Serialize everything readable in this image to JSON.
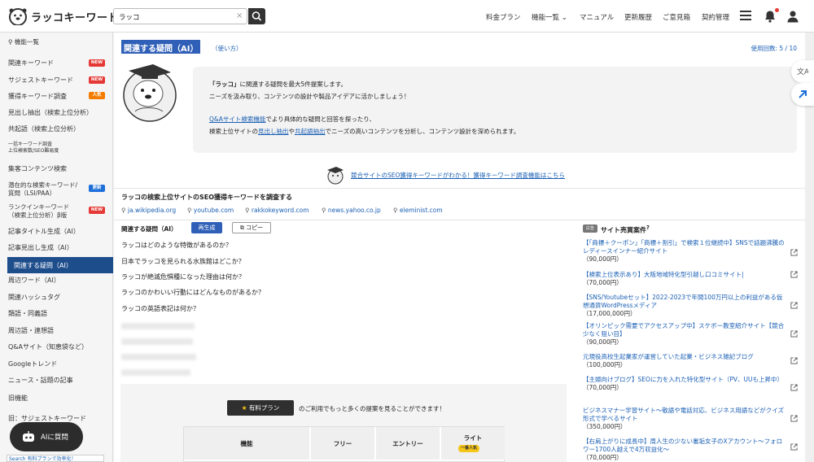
{
  "app": {
    "name": "ラッコキーワード"
  },
  "search": {
    "value": "ラッコ",
    "clear": "×"
  },
  "nav": {
    "items": [
      "料金プラン",
      "機能一覧 ⌄",
      "マニュアル",
      "更新履歴",
      "ご意見箱",
      "契約管理"
    ]
  },
  "sidebar": {
    "heading": "機能一覧",
    "items": [
      {
        "label": "関連キーワード",
        "badge": "NEW"
      },
      {
        "label": "サジェストキーワード",
        "badge": "NEW"
      },
      {
        "label": "獲得キーワード調査",
        "badge": "人気"
      },
      {
        "label": "見出し抽出（検索上位分析）"
      },
      {
        "label": "共起語（検索上位分析）"
      },
      {
        "label": "一括キーワード調査",
        "sub": "上位検索数/SEO難易度"
      },
      {
        "label": "集客コンテンツ検索"
      },
      {
        "label": "潜在的な検索キーワード/",
        "label2": "質問（LSI/PAA）",
        "badge": "更新"
      },
      {
        "label": "ランクインキーワード",
        "label2": "（検索上位分析）β版",
        "badge": "NEW"
      },
      {
        "label": "記事タイトル生成（AI）"
      },
      {
        "label": "記事見出し生成（AI）"
      },
      {
        "label": "関連する疑問（AI）"
      },
      {
        "label": "周辺ワード（AI）"
      },
      {
        "label": "関連ハッシュタグ"
      },
      {
        "label": "類語・同義語"
      },
      {
        "label": "周辺語・連想語"
      },
      {
        "label": "Q&Aサイト（知恵袋など）"
      },
      {
        "label": "Googleトレンド"
      },
      {
        "label": "ニュース・話題の記事"
      },
      {
        "label": "旧機能"
      },
      {
        "label": "旧：サジェストキーワード"
      }
    ],
    "ai_button": "AIに質問",
    "ad_text": "Search 有料プランで効率化！"
  },
  "main": {
    "title": "関連する疑問（AI）",
    "howto": "（使い方）",
    "usage": "使用回数: 5 / 10",
    "intro": {
      "line1_bold": "「ラッコ」",
      "line1_rest": "に関連する疑問を最大5件提案します。",
      "line2": "ニーズを汲み取り、コンテンツの設計や製品アイデアに活かしましょう！",
      "line3_link": "Q&Aサイト検索機能",
      "line3_rest": "でより具体的な疑問と回答を探ったり、",
      "line4_a": "検索上位サイトの",
      "line4_link1": "見出し抽出",
      "line4_mid": "や",
      "line4_link2": "共起語抽出",
      "line4_rest": "でニーズの高いコンテンツを分析し、コンテンツ設計を深められます。"
    },
    "promo": "競合サイトのSEO獲得キーワードがわかる！獲得キーワード調査機能はこちら",
    "seo_section": {
      "title": "ラッコの検索上位サイトのSEO獲得キーワードを調査する",
      "sites": [
        "ja.wikipedia.org",
        "youtube.com",
        "rakkokeyword.com",
        "news.yahoo.co.jp",
        "eleminist.com"
      ]
    },
    "questions": {
      "heading": "関連する疑問（AI）",
      "regen": "再生成",
      "copy": "コピー",
      "items": [
        "ラッコはどのような特徴があるのか？",
        "日本でラッコを見られる水族館はどこか？",
        "ラッコが絶滅危惧種になった理由は何か？",
        "ラッコのかわいい行動にはどんなものがあるか？",
        "ラッコの英語表記は何か？"
      ]
    },
    "paywall": {
      "button": "有料プラン",
      "text": "のご利用でもっと多くの提案を見ることができます！",
      "table_headers": [
        "機能",
        "フリー",
        "エントリー",
        "ライト"
      ],
      "lite_badge": "一番人気"
    },
    "deals": {
      "badge": "広告",
      "title": "サイト売買案件",
      "items": [
        {
          "title": "【「商標＋クーポン」「商標＋割引」で検索１位継続中】SNSで話題沸騰のレディースインナー紹介サイト",
          "price": "（90,000円）"
        },
        {
          "title": "【検索上位表示あり】大阪地域特化型引越し口コミサイト|",
          "price": "（70,000円）"
        },
        {
          "title": "【SNS/Youtubeセット】2022-2023で年間100万円以上の利益がある仮想通貨WordPressメディア",
          "price": "（17,000,000円）"
        },
        {
          "title": "【オリンピック需要でアクセスアップ中】スケボー教室紹介サイト【競合少なく狙い目】",
          "price": "（90,000円）"
        },
        {
          "title": "元現役高校生起業家が運営していた起業・ビジネス雑記ブログ",
          "price": "（100,000円）"
        },
        {
          "title": "【主婦向けブログ】SEOに力を入れた特化型サイト（PV、UUも上昇中）",
          "price": "（70,000円）"
        },
        {
          "title": "ビジネスマナー学習サイト～敬語や電話対応、ビジネス用語などがクイズ形式で学べるサイト",
          "price": "（350,000円）"
        },
        {
          "title": "【右肩上がりに成長中】周人生の少ない裏垢女子のXアカウント～フォロワー1700人越えで4万収益化～",
          "price": "（70,000円）"
        }
      ]
    }
  }
}
